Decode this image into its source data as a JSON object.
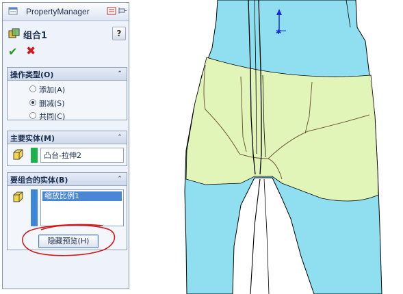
{
  "property_manager": {
    "title": "PropertyManager",
    "feature_name": "组合1",
    "help_label": "?"
  },
  "actions": {
    "ok_glyph": "✔",
    "cancel_glyph": "✖"
  },
  "operation_type": {
    "header": "操作类型(O)",
    "collapse_glyph": "⌃",
    "options": [
      {
        "label": "添加(A)",
        "selected": false
      },
      {
        "label": "删减(S)",
        "selected": true
      },
      {
        "label": "共同(C)",
        "selected": false
      }
    ]
  },
  "main_body": {
    "header": "主要实体(M)",
    "value": "凸台-拉伸2"
  },
  "combine_bodies": {
    "header": "要组合的实体(B)",
    "items": [
      "缩放比例1"
    ],
    "preview_button": "隐藏预览(H)"
  },
  "colors": {
    "accent_green": "#1fb24a",
    "accent_blue": "#3d86d8",
    "model_cyan": "#8fdff0",
    "model_yellow": "#e9f6b4",
    "annotation_red": "#d41818"
  }
}
